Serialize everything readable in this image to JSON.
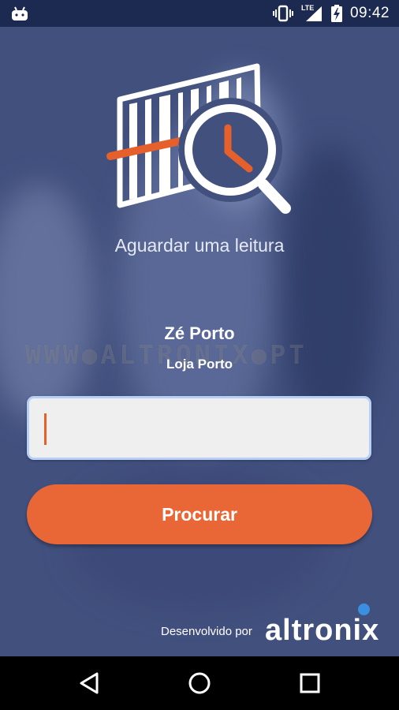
{
  "status_bar": {
    "time": "09:42",
    "icons": [
      "android-icon",
      "vibrate-icon",
      "lte-signal-icon",
      "battery-charging-icon"
    ],
    "network_label": "LTE"
  },
  "main": {
    "waiting_text": "Aguardar uma leitura",
    "user_name": "Zé Porto",
    "store_name": "Loja Porto",
    "watermark": "WWW●ALTRONIX●PT",
    "search_input": {
      "value": "",
      "placeholder": ""
    },
    "search_button_label": "Procurar"
  },
  "footer": {
    "developed_by": "Desenvolvido por",
    "brand_name": "altronix"
  },
  "nav_bar": {
    "icons": [
      "back-icon",
      "home-icon",
      "recents-icon"
    ]
  },
  "colors": {
    "background": "#42507e",
    "status_bar": "#1c2a52",
    "accent": "#e96737",
    "input_border": "#b7cef7",
    "brand_dot": "#3b8fe0"
  }
}
